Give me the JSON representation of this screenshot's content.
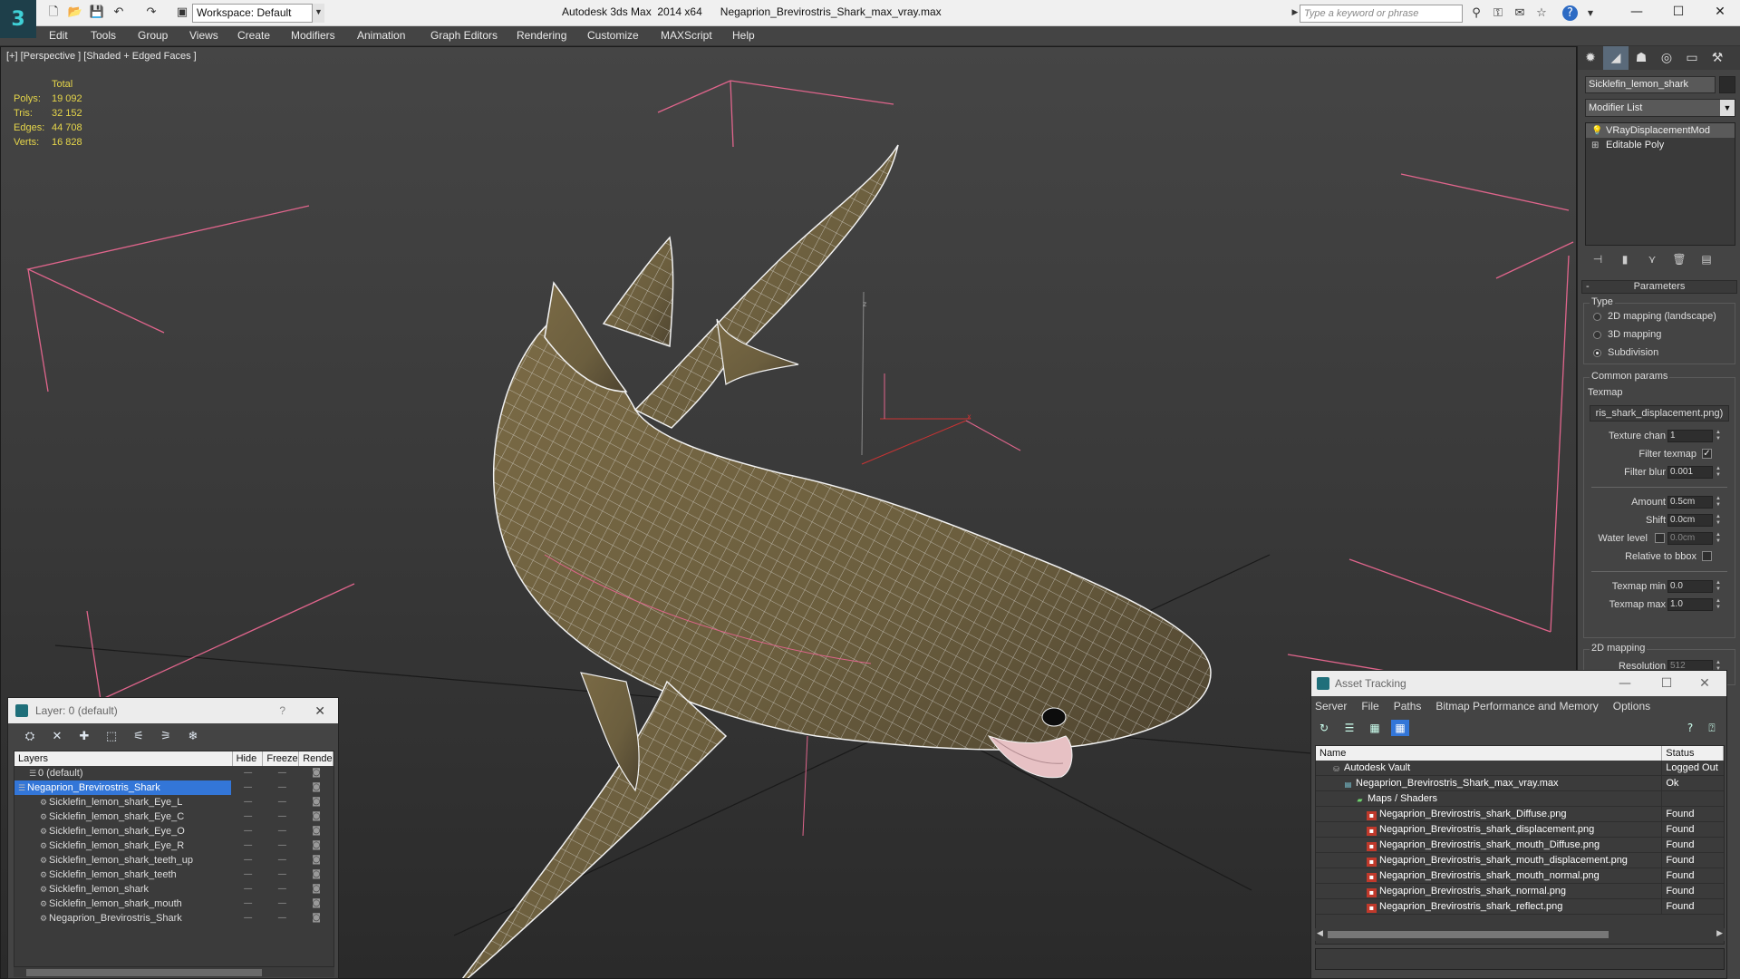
{
  "titlebar": {
    "app_logo": "3",
    "workspace": "Workspace: Default",
    "app_title": "Autodesk 3ds Max  2014 x64",
    "file_title": "Negaprion_Brevirostris_Shark_max_vray.max",
    "search_placeholder": "Type a keyword or phrase"
  },
  "menu": [
    "Edit",
    "Tools",
    "Group",
    "Views",
    "Create",
    "Modifiers",
    "Animation",
    "Graph Editors",
    "Rendering",
    "Customize",
    "MAXScript",
    "Help"
  ],
  "viewport": {
    "label": "[+] [Perspective ] [Shaded + Edged Faces ]",
    "stats": {
      "total_label": "Total",
      "rows": [
        {
          "k": "Polys:",
          "v": "19 092"
        },
        {
          "k": "Tris:",
          "v": "32 152"
        },
        {
          "k": "Edges:",
          "v": "44 708"
        },
        {
          "k": "Verts:",
          "v": "16 828"
        }
      ]
    },
    "axis_labels": {
      "z": "z",
      "x": "x"
    }
  },
  "command_panel": {
    "object_name": "Sicklefin_lemon_shark",
    "modifier_list": "Modifier List",
    "stack": [
      "VRayDisplacementMod",
      "Editable Poly"
    ],
    "parameters_title": "Parameters",
    "type_label": "Type",
    "type_options": [
      "2D mapping (landscape)",
      "3D mapping",
      "Subdivision"
    ],
    "type_selected": 2,
    "common_params_label": "Common params",
    "texmap_label": "Texmap",
    "texmap_value": "ris_shark_displacement.png)",
    "fields": [
      {
        "label": "Texture chan",
        "value": "1",
        "kind": "field"
      },
      {
        "label": "Filter texmap",
        "value": "✓",
        "kind": "check"
      },
      {
        "label": "Filter blur",
        "value": "0.001",
        "kind": "field"
      },
      {
        "label": "Amount",
        "value": "0.5cm",
        "kind": "field"
      },
      {
        "label": "Shift",
        "value": "0.0cm",
        "kind": "field"
      },
      {
        "label": "Water level",
        "value": "0.0cm",
        "kind": "field"
      },
      {
        "label": "Relative to bbox",
        "value": "",
        "kind": "check"
      },
      {
        "label": "Texmap min",
        "value": "0.0",
        "kind": "field"
      },
      {
        "label": "Texmap max",
        "value": "1.0",
        "kind": "field"
      }
    ],
    "mapping_label": "2D mapping",
    "resolution_label": "Resolution",
    "resolution_value": "512"
  },
  "layer_window": {
    "title": "Layer: 0 (default)",
    "help": "?",
    "columns": [
      "Layers",
      "Hide",
      "Freeze",
      "Rende"
    ],
    "rows": [
      {
        "name": "0 (default)",
        "indent": 1,
        "selected": false
      },
      {
        "name": "Negaprion_Brevirostris_Shark",
        "indent": 0,
        "selected": true
      },
      {
        "name": "Sicklefin_lemon_shark_Eye_L",
        "indent": 2,
        "selected": false
      },
      {
        "name": "Sicklefin_lemon_shark_Eye_C",
        "indent": 2,
        "selected": false
      },
      {
        "name": "Sicklefin_lemon_shark_Eye_O",
        "indent": 2,
        "selected": false
      },
      {
        "name": "Sicklefin_lemon_shark_Eye_R",
        "indent": 2,
        "selected": false
      },
      {
        "name": "Sicklefin_lemon_shark_teeth_up",
        "indent": 2,
        "selected": false
      },
      {
        "name": "Sicklefin_lemon_shark_teeth",
        "indent": 2,
        "selected": false
      },
      {
        "name": "Sicklefin_lemon_shark",
        "indent": 2,
        "selected": false
      },
      {
        "name": "Sicklefin_lemon_shark_mouth",
        "indent": 2,
        "selected": false
      },
      {
        "name": "Negaprion_Brevirostris_Shark",
        "indent": 2,
        "selected": false
      }
    ]
  },
  "asset_tracking": {
    "title": "Asset Tracking",
    "menu": [
      "Server",
      "File",
      "Paths",
      "Bitmap Performance and Memory",
      "Options"
    ],
    "columns": [
      "Name",
      "Status"
    ],
    "rows": [
      {
        "name": "Autodesk Vault",
        "status": "Logged Out",
        "indent": 1,
        "icon": "vault"
      },
      {
        "name": "Negaprion_Brevirostris_Shark_max_vray.max",
        "status": "Ok",
        "indent": 2,
        "icon": "max"
      },
      {
        "name": "Maps / Shaders",
        "status": "",
        "indent": 3,
        "icon": "folder"
      },
      {
        "name": "Negaprion_Brevirostris_shark_Diffuse.png",
        "status": "Found",
        "indent": 4,
        "icon": "png"
      },
      {
        "name": "Negaprion_Brevirostris_shark_displacement.png",
        "status": "Found",
        "indent": 4,
        "icon": "png"
      },
      {
        "name": "Negaprion_Brevirostris_shark_mouth_Diffuse.png",
        "status": "Found",
        "indent": 4,
        "icon": "png"
      },
      {
        "name": "Negaprion_Brevirostris_shark_mouth_displacement.png",
        "status": "Found",
        "indent": 4,
        "icon": "png"
      },
      {
        "name": "Negaprion_Brevirostris_shark_mouth_normal.png",
        "status": "Found",
        "indent": 4,
        "icon": "png"
      },
      {
        "name": "Negaprion_Brevirostris_shark_normal.png",
        "status": "Found",
        "indent": 4,
        "icon": "png"
      },
      {
        "name": "Negaprion_Brevirostris_shark_reflect.png",
        "status": "Found",
        "indent": 4,
        "icon": "png"
      }
    ]
  },
  "colors": {
    "viewport_bg": "#3a3a3a",
    "shark_skin": "#6b5e3e",
    "wire": "#f2f2f2",
    "grid_line": "#111111",
    "bbox_pink": "#e0658c",
    "stats_yellow": "#e6d64a",
    "selection_blue": "#3376d8",
    "png_icon_red": "#c0392b"
  }
}
